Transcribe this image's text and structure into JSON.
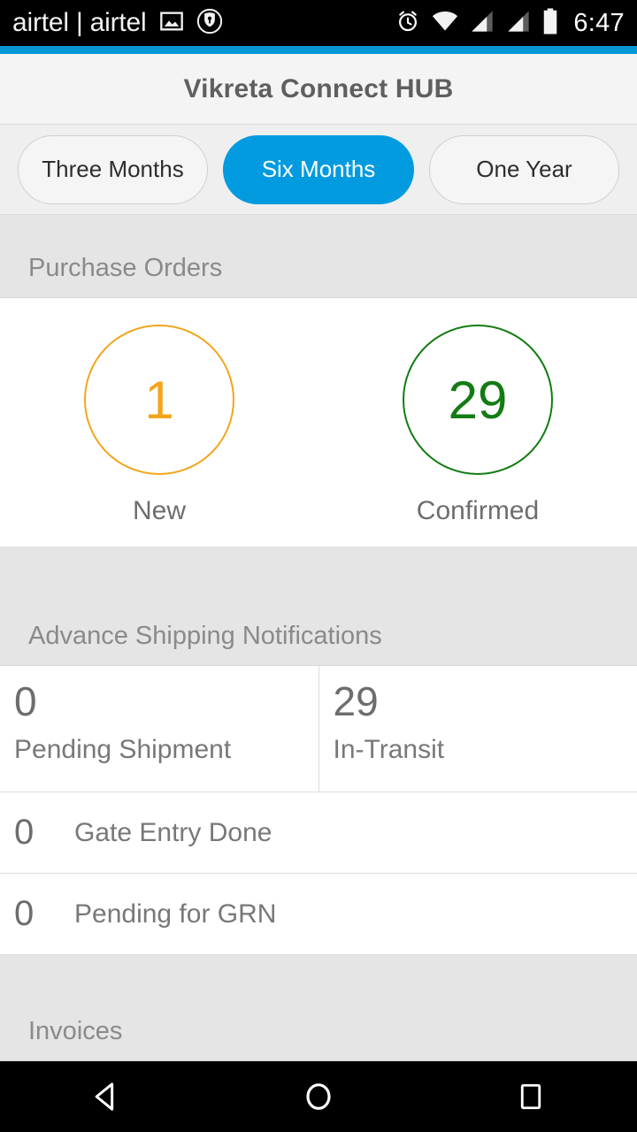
{
  "statusbar": {
    "carrier": "airtel | airtel",
    "clock": "6:47",
    "icons_left": [
      "image-icon",
      "vpn-key-badge-icon"
    ],
    "icons_right": [
      "alarm-icon",
      "wifi-icon",
      "signal-icon",
      "signal-icon",
      "battery-icon"
    ]
  },
  "appbar": {
    "title": "Vikreta Connect HUB",
    "accent_color": "#0598d5"
  },
  "segments": {
    "options": [
      "Three Months",
      "Six Months",
      "One Year"
    ],
    "selected": "Six Months",
    "selected_color": "#039be0"
  },
  "sections": {
    "purchase_orders": {
      "title": "Purchase Orders",
      "stats": [
        {
          "value": "1",
          "label": "New",
          "color": "#f2a51c"
        },
        {
          "value": "29",
          "label": "Confirmed",
          "color": "#137c13"
        }
      ]
    },
    "asn": {
      "title": "Advance Shipping Notifications",
      "top_cells": [
        {
          "value": "0",
          "label": "Pending Shipment"
        },
        {
          "value": "29",
          "label": "In-Transit"
        }
      ],
      "rows": [
        {
          "value": "0",
          "label": "Gate Entry Done"
        },
        {
          "value": "0",
          "label": "Pending for GRN"
        }
      ]
    },
    "invoices": {
      "title": "Invoices"
    }
  },
  "navbar": {
    "buttons": [
      "back-button",
      "home-button",
      "recents-button"
    ]
  }
}
